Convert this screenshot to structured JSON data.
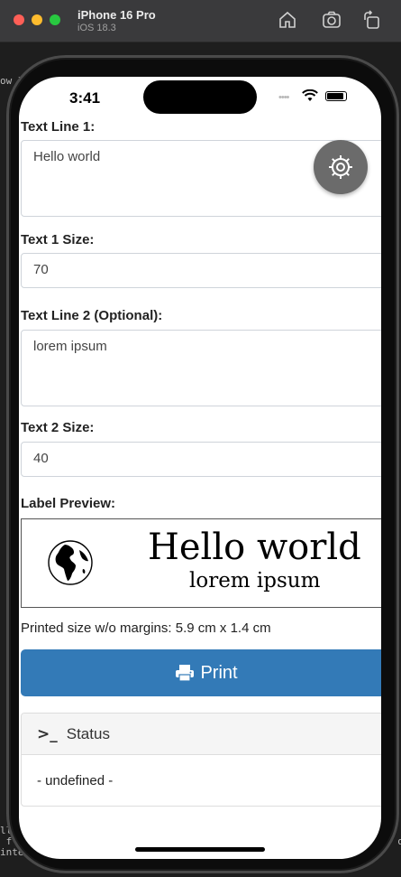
{
  "simulator": {
    "device_name": "iPhone 16 Pro",
    "os_version": "iOS 18.3",
    "icons": [
      "home-icon",
      "screenshot-icon",
      "rotate-icon"
    ]
  },
  "status_bar": {
    "time": "3:41",
    "signal_dots": "••••"
  },
  "form": {
    "text1_label": "Text Line 1:",
    "text1_value": "Hello world",
    "size1_label": "Text 1 Size:",
    "size1_value": "70",
    "text2_label": "Text Line 2 (Optional):",
    "text2_value": "lorem ipsum",
    "size2_label": "Text 2 Size:",
    "size2_value": "40"
  },
  "preview": {
    "label": "Label Preview:",
    "line1": "Hello world",
    "line2": "lorem ipsum",
    "icon": "globe-icon"
  },
  "printed_size": "Printed size w/o margins: 5.9 cm x 1.4 cm",
  "print_button": {
    "label": "Print",
    "color": "#337ab7",
    "icon": "printer-icon"
  },
  "status_panel": {
    "title": "Status",
    "prompt_glyph": ">_",
    "body": "- undefined -"
  },
  "fab_icon": "gear-icon"
}
